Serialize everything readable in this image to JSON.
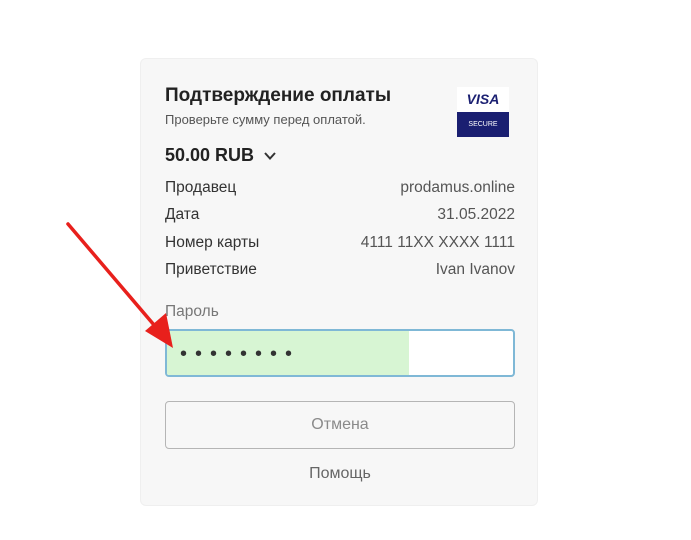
{
  "header": {
    "title": "Подтверждение оплаты",
    "subtitle": "Проверьте сумму перед оплатой."
  },
  "brand": {
    "logo_text": "VISA",
    "logo_subtext": "SECURE",
    "color": "#1a1f71"
  },
  "amount": {
    "text": "50.00 RUB",
    "icon": "chevron-down-icon"
  },
  "details": [
    {
      "label": "Продавец",
      "value": "prodamus.online"
    },
    {
      "label": "Дата",
      "value": "31.05.2022"
    },
    {
      "label": "Номер карты",
      "value": "4111 11XX XXXX 1111"
    },
    {
      "label": "Приветствие",
      "value": "Ivan Ivanov"
    }
  ],
  "password": {
    "label": "Пароль",
    "masked_value": "••••••••",
    "highlight_color": "#d7f5d3"
  },
  "buttons": {
    "cancel": "Отмена",
    "help": "Помощь"
  },
  "annotation": {
    "arrow_color": "#e8201c"
  }
}
